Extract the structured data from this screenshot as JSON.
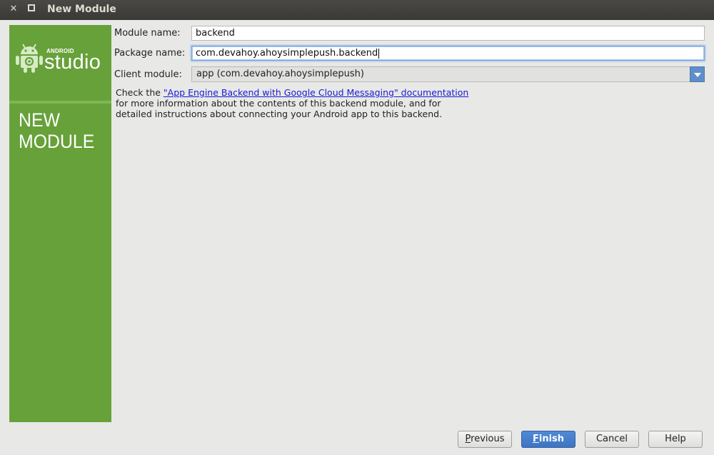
{
  "window": {
    "title": "New Module"
  },
  "sidebar": {
    "logo_small": "ANDROID",
    "logo_big": "studio",
    "section_line1": "NEW",
    "section_line2": "MODULE"
  },
  "form": {
    "module_name": {
      "label": "Module name:",
      "value": "backend"
    },
    "package_name": {
      "label": "Package name:",
      "value": "com.devahoy.ahoysimplepush.backend"
    },
    "client_module": {
      "label": "Client module:",
      "value": "app (com.devahoy.ahoysimplepush)"
    }
  },
  "info": {
    "prefix": "Check the ",
    "link": "\"App Engine Backend with Google Cloud Messaging\" documentation",
    "line2": "for more information about the contents of this backend module, and for",
    "line3": "detailed instructions about connecting your Android app to this backend."
  },
  "buttons": {
    "previous_mnemonic": "P",
    "previous_rest": "revious",
    "finish_mnemonic": "F",
    "finish_rest": "inish",
    "cancel": "Cancel",
    "help": "Help"
  },
  "colors": {
    "sidebar": "#67a13a",
    "primary_button": "#3f74c2",
    "link": "#1a1ad4"
  }
}
